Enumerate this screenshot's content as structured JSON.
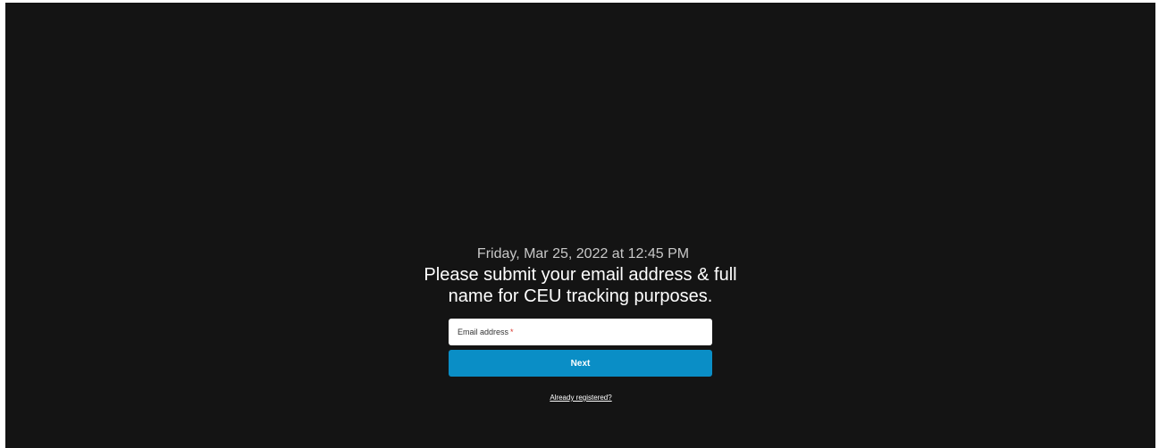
{
  "event": {
    "datetime": "Friday, Mar 25, 2022 at 12:45 PM",
    "headline": "Please submit your email address & full name for CEU tracking purposes."
  },
  "form": {
    "email_label": "Email address",
    "required_marker": "*",
    "next_label": "Next",
    "already_registered_label": "Already registered?"
  },
  "colors": {
    "background": "#141414",
    "accent_button": "#0a8ec6",
    "required": "#d9342b"
  }
}
